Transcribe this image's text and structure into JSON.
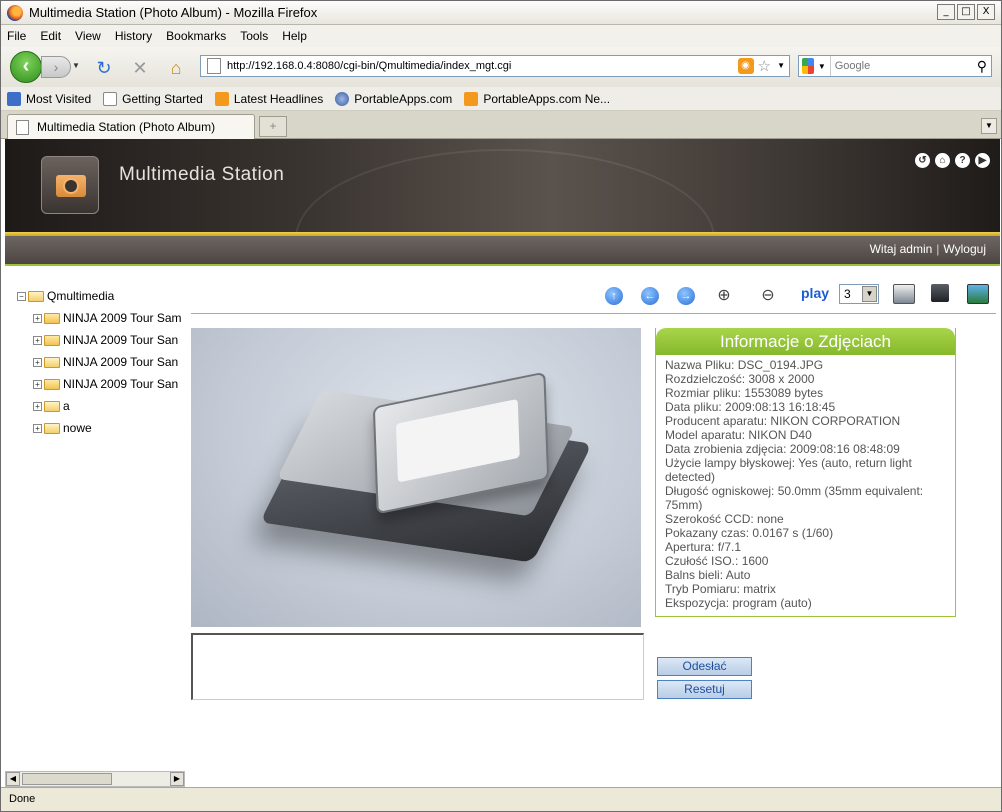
{
  "window": {
    "title": "Multimedia Station (Photo Album) - Mozilla Firefox",
    "min": "_",
    "max": "□",
    "close": "X"
  },
  "menu": [
    "File",
    "Edit",
    "View",
    "History",
    "Bookmarks",
    "Tools",
    "Help"
  ],
  "nav": {
    "url": "http://192.168.0.4:8080/cgi-bin/Qmultimedia/index_mgt.cgi",
    "search_placeholder": "Google"
  },
  "bookmarks": [
    {
      "label": "Most Visited",
      "icon": "most-visited-icon",
      "style": "blue"
    },
    {
      "label": "Getting Started",
      "icon": "page-icon",
      "style": "page"
    },
    {
      "label": "Latest Headlines",
      "icon": "rss-icon",
      "style": "rss"
    },
    {
      "label": "PortableApps.com",
      "icon": "globe-icon",
      "style": "globe"
    },
    {
      "label": "PortableApps.com Ne...",
      "icon": "rss-icon",
      "style": "rss"
    }
  ],
  "tab": {
    "label": "Multimedia Station (Photo Album)"
  },
  "header": {
    "app_title": "Multimedia Station",
    "user_greeting": "Witaj admin",
    "separator": "|",
    "logout": "Wyloguj"
  },
  "tree": {
    "root": "Qmultimedia",
    "items": [
      {
        "label": "NINJA 2009 Tour Sam",
        "pm": "+"
      },
      {
        "label": "NINJA 2009 Tour San",
        "pm": "+"
      },
      {
        "label": "NINJA 2009 Tour San",
        "pm": "+"
      },
      {
        "label": "NINJA 2009 Tour San",
        "pm": "+"
      },
      {
        "label": "a",
        "pm": "+"
      },
      {
        "label": "nowe",
        "pm": "+"
      }
    ]
  },
  "toolbar": {
    "play_label": "play",
    "interval_value": "3"
  },
  "info": {
    "title": "Informacje o Zdjęciach",
    "lines": [
      "Nazwa Pliku: DSC_0194.JPG",
      "Rozdzielczość: 3008 x 2000",
      "Rozmiar pliku: 1553089 bytes",
      "Data pliku: 2009:08:13 16:18:45",
      "Producent aparatu: NIKON CORPORATION",
      "Model aparatu: NIKON D40",
      "Data zrobienia zdjęcia: 2009:08:16 08:48:09",
      "Użycie lampy błyskowej: Yes (auto, return light detected)",
      "Długość ogniskowej: 50.0mm (35mm equivalent: 75mm)",
      "Szerokość CCD: none",
      "Pokazany czas: 0.0167 s (1/60)",
      "Apertura: f/7.1",
      "Czułość ISO.: 1600",
      "Balns bieli: Auto",
      "Tryb Pomiaru: matrix",
      "Ekspozycja: program (auto)"
    ]
  },
  "form": {
    "submit_label": "Odesłać",
    "reset_label": "Resetuj"
  },
  "status": "Done"
}
